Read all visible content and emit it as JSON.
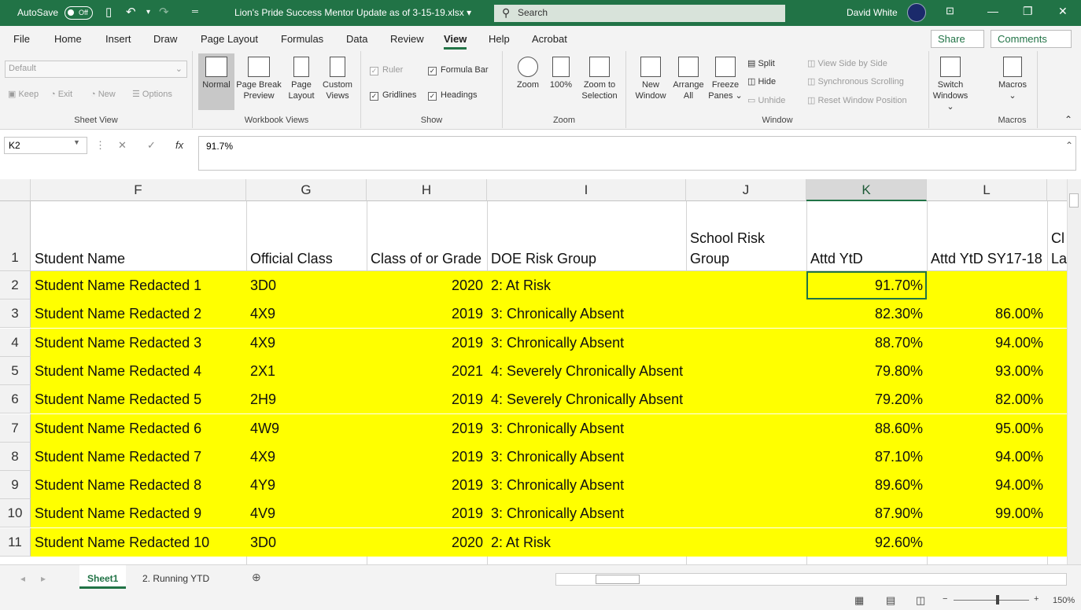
{
  "titlebar": {
    "autosave": "AutoSave",
    "toggle": "Off",
    "doc": "Lion's Pride Success Mentor Update as of 3-15-19.xlsx",
    "search": "Search",
    "user": "David White"
  },
  "tabs": [
    "File",
    "Home",
    "Insert",
    "Draw",
    "Page Layout",
    "Formulas",
    "Data",
    "Review",
    "View",
    "Help",
    "Acrobat"
  ],
  "active_tab": "View",
  "share": "Share",
  "comments": "Comments",
  "ribbon": {
    "sheet_view": {
      "select": "Default",
      "keep": "Keep",
      "exit": "Exit",
      "new": "New",
      "options": "Options",
      "label": "Sheet View"
    },
    "workbook_views": {
      "normal": "Normal",
      "page_break": "Page Break Preview",
      "page_layout": "Page Layout",
      "custom": "Custom Views",
      "label": "Workbook Views"
    },
    "show": {
      "ruler": "Ruler",
      "formula_bar": "Formula Bar",
      "gridlines": "Gridlines",
      "headings": "Headings",
      "label": "Show"
    },
    "zoom": {
      "zoom": "Zoom",
      "hundred": "100%",
      "selection": "Zoom to Selection",
      "label": "Zoom"
    },
    "window": {
      "new": "New Window",
      "arrange": "Arrange All",
      "freeze": "Freeze Panes",
      "split": "Split",
      "hide": "Hide",
      "unhide": "Unhide",
      "side": "View Side by Side",
      "sync": "Synchronous Scrolling",
      "reset": "Reset Window Position",
      "switch": "Switch Windows",
      "label": "Window"
    },
    "macros": {
      "macros": "Macros",
      "label": "Macros"
    }
  },
  "namebox": "K2",
  "formula": "91.7%",
  "columns": [
    "F",
    "G",
    "H",
    "I",
    "J",
    "K",
    "L"
  ],
  "header_row": {
    "num": "1",
    "f": "Student Name",
    "g": "Official Class",
    "h": "Class of or Grade",
    "i": "DOE Risk Group",
    "j": "School Risk Group",
    "k": "Attd YtD",
    "l": "Attd YtD SY17-18",
    "m": "Cl La"
  },
  "rows": [
    {
      "num": "2",
      "name": "Student Name Redacted 1",
      "cls": "3D0",
      "year": "2020",
      "risk": "2: At Risk",
      "attd": "91.70%",
      "prev": ""
    },
    {
      "num": "3",
      "name": "Student Name Redacted 2",
      "cls": "4X9",
      "year": "2019",
      "risk": "3: Chronically Absent",
      "attd": "82.30%",
      "prev": "86.00%"
    },
    {
      "num": "4",
      "name": "Student Name Redacted 3",
      "cls": "4X9",
      "year": "2019",
      "risk": "3: Chronically Absent",
      "attd": "88.70%",
      "prev": "94.00%"
    },
    {
      "num": "5",
      "name": "Student Name Redacted 4",
      "cls": "2X1",
      "year": "2021",
      "risk": "4: Severely Chronically Absent",
      "attd": "79.80%",
      "prev": "93.00%"
    },
    {
      "num": "6",
      "name": "Student Name Redacted 5",
      "cls": "2H9",
      "year": "2019",
      "risk": "4: Severely Chronically Absent",
      "attd": "79.20%",
      "prev": "82.00%"
    },
    {
      "num": "7",
      "name": "Student Name Redacted 6",
      "cls": "4W9",
      "year": "2019",
      "risk": "3: Chronically Absent",
      "attd": "88.60%",
      "prev": "95.00%"
    },
    {
      "num": "8",
      "name": "Student Name Redacted 7",
      "cls": "4X9",
      "year": "2019",
      "risk": "3: Chronically Absent",
      "attd": "87.10%",
      "prev": "94.00%"
    },
    {
      "num": "9",
      "name": "Student Name Redacted 8",
      "cls": "4Y9",
      "year": "2019",
      "risk": "3: Chronically Absent",
      "attd": "89.60%",
      "prev": "94.00%"
    },
    {
      "num": "10",
      "name": "Student Name Redacted 9",
      "cls": "4V9",
      "year": "2019",
      "risk": "3: Chronically Absent",
      "attd": "87.90%",
      "prev": "99.00%"
    },
    {
      "num": "11",
      "name": "Student Name Redacted 10",
      "cls": "3D0",
      "year": "2020",
      "risk": "2: At Risk",
      "attd": "92.60%",
      "prev": ""
    }
  ],
  "sheets": [
    "Sheet1",
    "2. Running YTD"
  ],
  "status": {
    "zoom": "150%"
  }
}
